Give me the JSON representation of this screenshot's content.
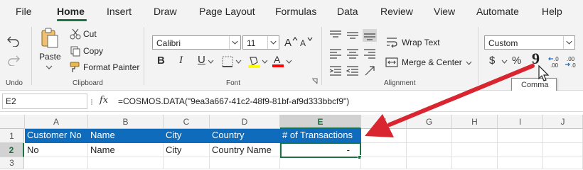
{
  "menu": {
    "tabs": [
      "File",
      "Home",
      "Insert",
      "Draw",
      "Page Layout",
      "Formulas",
      "Data",
      "Review",
      "View",
      "Automate",
      "Help"
    ],
    "active_tab": "Home"
  },
  "ribbon": {
    "undo": {
      "group_label": "Undo"
    },
    "clipboard": {
      "paste_label": "Paste",
      "cut_label": "Cut",
      "copy_label": "Copy",
      "format_painter_label": "Format Painter",
      "group_label": "Clipboard"
    },
    "font": {
      "font_name": "Calibri",
      "font_size": "11",
      "bold_label": "B",
      "italic_label": "I",
      "underline_label": "U",
      "highlight_color": "#ffff00",
      "font_color": "#ff0000",
      "group_label": "Font"
    },
    "alignment": {
      "wrap_text_label": "Wrap Text",
      "merge_center_label": "Merge & Center",
      "group_label": "Alignment"
    },
    "number": {
      "format_value": "Custom",
      "currency_symbol": "$",
      "percent_symbol": "%",
      "comma_symbol": "9",
      "tooltip": "Comma"
    }
  },
  "formula_bar": {
    "cell_ref": "E2",
    "fx_label": "fx",
    "formula": "=COSMOS.DATA(\"9ea3a667-41c2-48f9-81bf-af9d333bbcf9\")"
  },
  "sheet": {
    "columns": [
      "A",
      "B",
      "C",
      "D",
      "E",
      "F",
      "G",
      "H",
      "I",
      "J"
    ],
    "rows": [
      "1",
      "2",
      "3"
    ],
    "header_row": [
      "Customer No",
      "Name",
      "City",
      "Country",
      "# of Transactions"
    ],
    "data_row": [
      "No",
      "Name",
      "City",
      "Country Name",
      "-"
    ],
    "selected_cell": "E2",
    "header_fill": "#0f6cbd",
    "accent": "#1e7145"
  },
  "annotation": {
    "arrow_color": "#d9252f"
  }
}
